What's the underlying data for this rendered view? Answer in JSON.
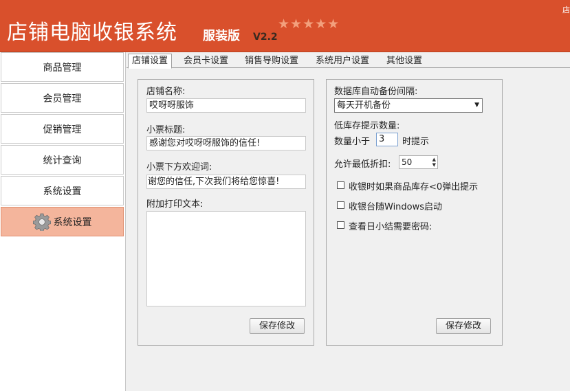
{
  "header": {
    "title": "店铺电脑收银系统",
    "edition": "服装版",
    "version": "V2.2",
    "stars": "★★★★★",
    "corner": "店"
  },
  "sidebar": {
    "items": [
      {
        "label": "商品管理"
      },
      {
        "label": "会员管理"
      },
      {
        "label": "促销管理"
      },
      {
        "label": "统计查询"
      },
      {
        "label": "系统设置"
      },
      {
        "label": "系统设置",
        "icon": "gear-icon",
        "active": true
      }
    ]
  },
  "tabs": [
    {
      "label": "店铺设置",
      "active": true
    },
    {
      "label": "会员卡设置"
    },
    {
      "label": "销售导购设置"
    },
    {
      "label": "系统用户设置"
    },
    {
      "label": "其他设置"
    }
  ],
  "store_panel": {
    "name_label": "店铺名称:",
    "name_value": "哎呀呀服饰",
    "receipt_title_label": "小票标题:",
    "receipt_title_value": "感谢您对哎呀呀服饰的信任!",
    "footer_label": "小票下方欢迎词:",
    "footer_value": "谢您的信任,下次我们将给您惊喜!",
    "extra_label": "附加打印文本:",
    "extra_value": "",
    "save_label": "保存修改"
  },
  "system_panel": {
    "backup_label": "数据库自动备份间隔:",
    "backup_value": "每天开机备份",
    "low_stock_label": "低库存提示数量:",
    "qty_prefix": "数量小于",
    "qty_value": "3",
    "qty_suffix": "时提示",
    "discount_label": "允许最低折扣:",
    "discount_value": "50",
    "checkboxes": [
      {
        "label": "收银时如果商品库存<0弹出提示",
        "checked": false
      },
      {
        "label": "收银台随Windows启动",
        "checked": false
      },
      {
        "label": "查看日小结需要密码:",
        "checked": false
      }
    ],
    "save_label": "保存修改"
  },
  "colors": {
    "header_bg": "#d9502c",
    "active_item_bg": "#f4b59c"
  }
}
